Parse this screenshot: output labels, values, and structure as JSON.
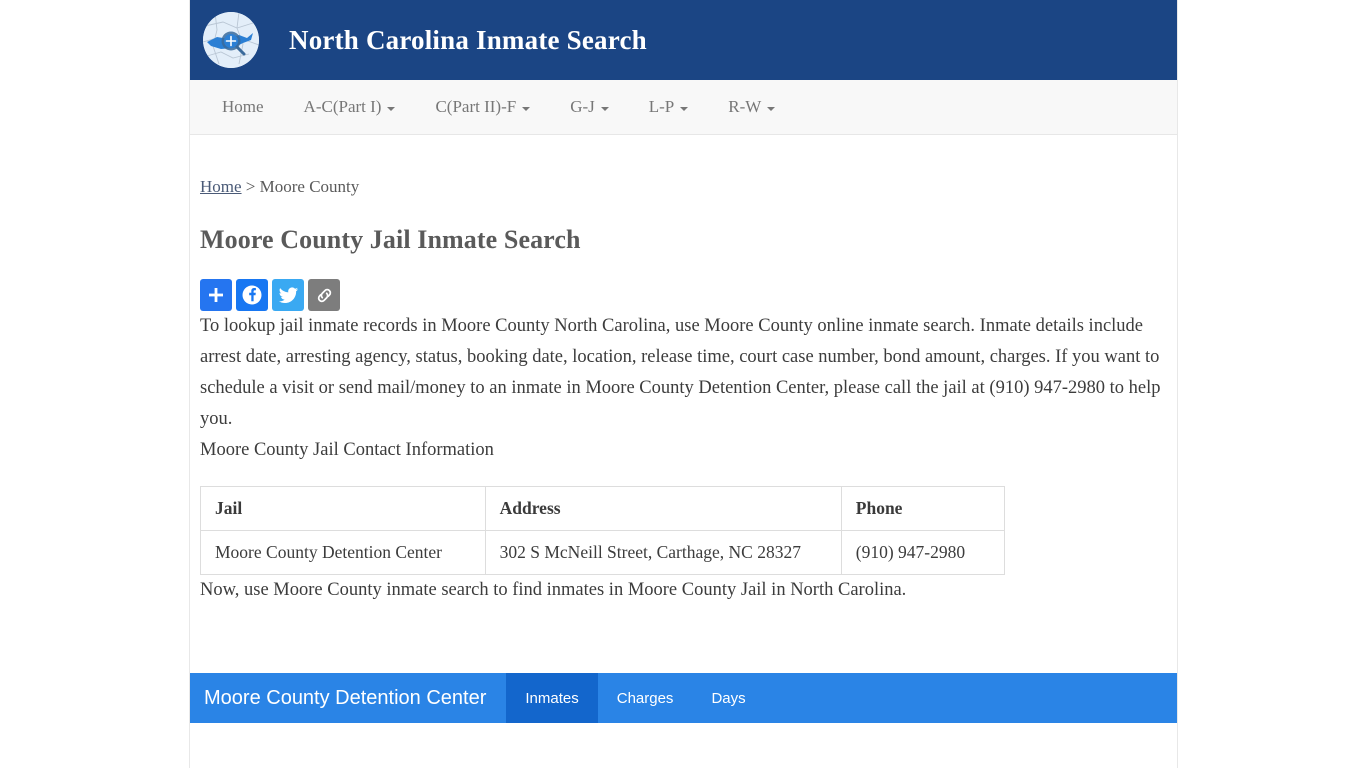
{
  "site": {
    "title": "North Carolina Inmate Search",
    "logo_icon": "nc-map-magnifier-icon"
  },
  "nav": {
    "items": [
      {
        "label": "Home",
        "has_caret": false
      },
      {
        "label": "A-C(Part I)",
        "has_caret": true
      },
      {
        "label": "C(Part II)-F",
        "has_caret": true
      },
      {
        "label": "G-J",
        "has_caret": true
      },
      {
        "label": "L-P",
        "has_caret": true
      },
      {
        "label": "R-W",
        "has_caret": true
      }
    ]
  },
  "breadcrumb": {
    "home_label": "Home",
    "separator": " > ",
    "current": "Moore County"
  },
  "page": {
    "title": "Moore County Jail Inmate Search",
    "intro_paragraph": "To lookup jail inmate records in Moore County North Carolina, use Moore County online inmate search. Inmate details include arrest date, arresting agency, status, booking date, location, release time, court case number, bond amount, charges. If you want to schedule a visit or send mail/money to an inmate in Moore County Detention Center, please call the jail at (910) 947-2980 to help you.",
    "contact_heading": "Moore County Jail Contact Information",
    "outro_paragraph": "Now, use Moore County inmate search to find inmates in Moore County Jail in North Carolina."
  },
  "share": {
    "buttons": [
      {
        "name": "addthis-share-button",
        "icon": "plus-icon",
        "color": "#2575f0"
      },
      {
        "name": "facebook-share-button",
        "icon": "facebook-icon",
        "color": "#1877f2"
      },
      {
        "name": "twitter-share-button",
        "icon": "twitter-bird-icon",
        "color": "#3aa9f2"
      },
      {
        "name": "copy-link-button",
        "icon": "chain-link-icon",
        "color": "#7d7d7d"
      }
    ]
  },
  "contact_table": {
    "headers": [
      "Jail",
      "Address",
      "Phone"
    ],
    "rows": [
      [
        "Moore County Detention Center",
        "302 S McNeill Street, Carthage, NC 28327",
        "(910) 947-2980"
      ]
    ]
  },
  "tabbar": {
    "brand": "Moore County Detention Center",
    "tabs": [
      {
        "label": "Inmates",
        "active": true
      },
      {
        "label": "Charges",
        "active": false
      },
      {
        "label": "Days",
        "active": false
      }
    ],
    "bar_color": "#2a84e6",
    "active_tab_color": "#1366cc"
  },
  "colors": {
    "header_navy": "#1b4584",
    "navbar_bg": "#f8f8f8",
    "accent_blue": "#2a84e6"
  }
}
